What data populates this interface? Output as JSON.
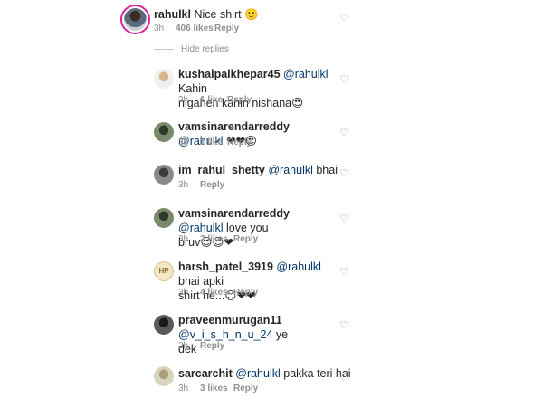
{
  "main_comment": {
    "username": "rahulkl",
    "text": "Nice shirt 🙂",
    "time": "3h",
    "likes": "406 likes",
    "reply": "Reply"
  },
  "hide_replies": "Hide replies",
  "replies": [
    {
      "username": "kushalpalkhepar45",
      "mention": "@rahulkl",
      "text_line1": " Kahin",
      "text_line2": "nigahen kahin nishana😍",
      "time": "3h",
      "likes": "1 like",
      "reply": "Reply"
    },
    {
      "username": "vamsinarendarreddy",
      "mention": "@rahulkl",
      "text_line1": " ❤❤😍",
      "text_line2": "",
      "time": "3h",
      "likes": "1 like",
      "reply": "Reply"
    },
    {
      "username": "im_rahul_shetty",
      "mention": "@rahulkl",
      "text_line1": " bhai",
      "text_line2": "",
      "time": "3h",
      "likes": "",
      "reply": "Reply"
    },
    {
      "username": "vamsinarendarreddy",
      "mention": "@rahulkl",
      "text_line1": " love you",
      "text_line2": "bruv😍😍❤",
      "time": "3h",
      "likes": "2 likes",
      "reply": "Reply"
    },
    {
      "username": "harsh_patel_3919",
      "mention": "@rahulkl",
      "text_line1": " bhai apki",
      "text_line2": "shirt he...😊❤❤",
      "time": "3h",
      "likes": "4 likes",
      "reply": "Reply"
    },
    {
      "username": "praveenmurugan11",
      "mention": "@v_i_s_h_n_u_24",
      "text_line1": " ye",
      "text_line2": "dek",
      "time": "3h",
      "likes": "",
      "reply": "Reply"
    },
    {
      "username": "sarcarchit",
      "mention": "@rahulkl",
      "text_line1": " pakka teri hai",
      "text_line2": "",
      "time": "3h",
      "likes": "3 likes",
      "reply": "Reply"
    }
  ]
}
